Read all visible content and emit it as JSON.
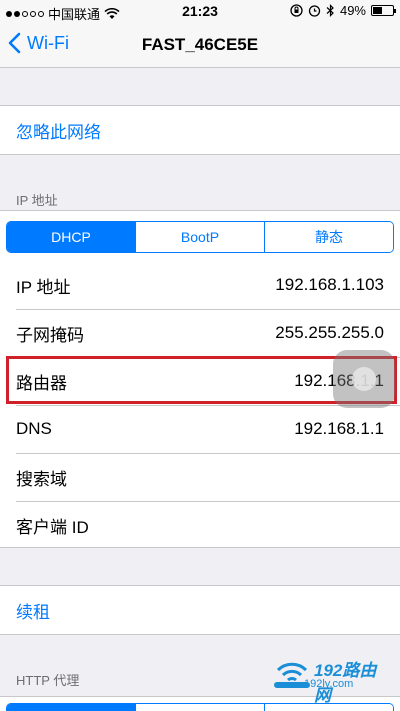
{
  "status_bar": {
    "carrier": "中国联通",
    "time": "21:23",
    "battery_percent": "49%",
    "battery_level": 0.49,
    "icons": [
      "wifi-icon",
      "orientation-lock-icon",
      "alarm-icon",
      "bluetooth-icon",
      "battery-icon"
    ]
  },
  "nav": {
    "back_label": "Wi-Fi",
    "title": "FAST_46CE5E"
  },
  "forget_network": {
    "label": "忽略此网络"
  },
  "ip_section": {
    "header": "IP 地址",
    "segments": [
      "DHCP",
      "BootP",
      "静态"
    ],
    "selected": "DHCP",
    "rows": [
      {
        "label": "IP 地址",
        "value": "192.168.1.103"
      },
      {
        "label": "子网掩码",
        "value": "255.255.255.0"
      },
      {
        "label": "路由器",
        "value": "192.168.1.1"
      },
      {
        "label": "DNS",
        "value": "192.168.1.1"
      },
      {
        "label": "搜索域",
        "value": ""
      },
      {
        "label": "客户端 ID",
        "value": ""
      }
    ]
  },
  "renew": {
    "label": "续租"
  },
  "http_proxy": {
    "header": "HTTP 代理"
  },
  "watermark": {
    "brand": "192路由网",
    "url": "192ly.com"
  },
  "colors": {
    "accent": "#007aff",
    "highlight": "#d0202a",
    "background": "#efeff4"
  }
}
